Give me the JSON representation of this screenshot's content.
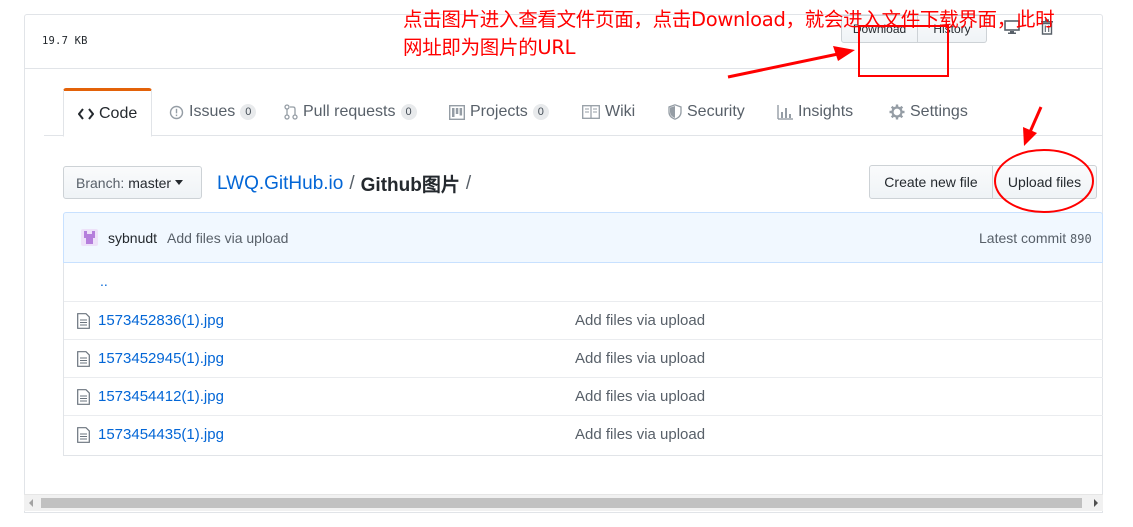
{
  "file_header": {
    "size": "19.7 KB",
    "download_label": "Download",
    "history_label": "History",
    "desktop_icon": "desktop-icon",
    "trash_icon": "trash-icon"
  },
  "tabs": [
    {
      "label": "Code",
      "icon": "code-icon",
      "selected": true
    },
    {
      "label": "Issues",
      "icon": "issue-icon",
      "count": "0"
    },
    {
      "label": "Pull requests",
      "icon": "pull-request-icon",
      "count": "0"
    },
    {
      "label": "Projects",
      "icon": "project-icon",
      "count": "0"
    },
    {
      "label": "Wiki",
      "icon": "book-icon"
    },
    {
      "label": "Security",
      "icon": "shield-icon"
    },
    {
      "label": "Insights",
      "icon": "graph-icon"
    },
    {
      "label": "Settings",
      "icon": "gear-icon"
    }
  ],
  "branch": {
    "prefix": "Branch:",
    "name": "master"
  },
  "breadcrumb": {
    "repo": "LWQ.GitHub.io",
    "separator": "/",
    "directory": "Github图片",
    "trailing": "/"
  },
  "actions": {
    "create_label": "Create new file",
    "upload_label": "Upload files"
  },
  "commit": {
    "author": "sybnudt",
    "message": "Add files via upload",
    "latest_label": "Latest commit",
    "sha_fragment": "890"
  },
  "files": {
    "parent": "..",
    "items": [
      {
        "name": "1573452836(1).jpg",
        "message": "Add files via upload"
      },
      {
        "name": "1573452945(1).jpg",
        "message": "Add files via upload"
      },
      {
        "name": "1573454412(1).jpg",
        "message": "Add files via upload"
      },
      {
        "name": "1573454435(1).jpg",
        "message": "Add files via upload"
      }
    ]
  },
  "annotation": {
    "line1": "点击图片进入查看文件页面，点击Download，就会进入文件下载界面，此时",
    "line2": "网址即为图片的URL",
    "color": "#ff0000"
  },
  "colors": {
    "link": "#0366d6",
    "tab_accent": "#e36209",
    "commit_bg": "#f1f8ff"
  }
}
